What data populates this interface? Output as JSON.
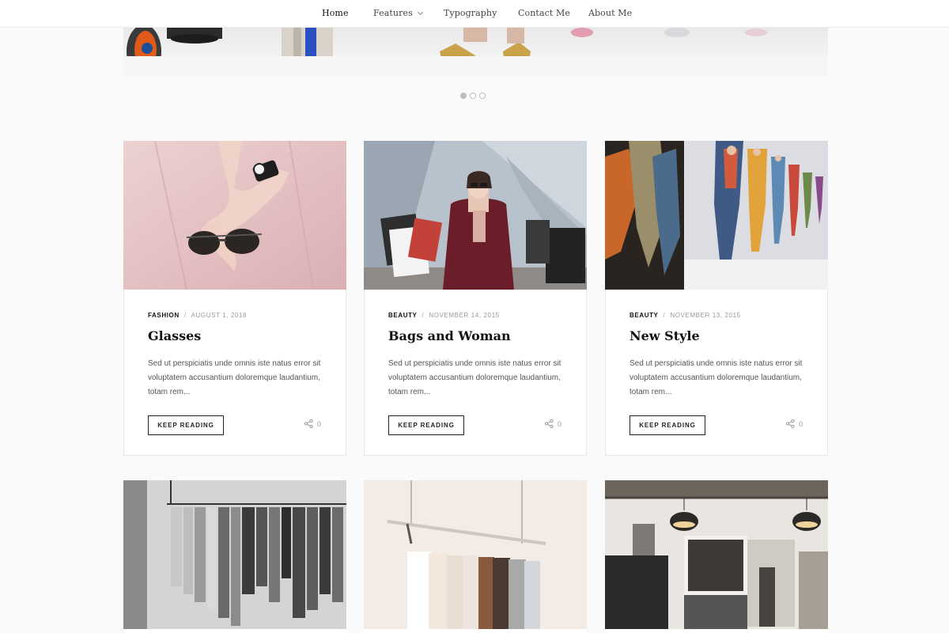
{
  "nav": {
    "items": [
      {
        "label": "Home",
        "active": true
      },
      {
        "label": "Features",
        "has_dropdown": true
      },
      {
        "label": "Typography"
      },
      {
        "label": "Contact Me"
      },
      {
        "label": "About Me"
      }
    ]
  },
  "slider": {
    "dots": 3,
    "active_dot": 1
  },
  "posts": [
    {
      "category": "Fashion",
      "date": "August 1, 2018",
      "title": "Glasses",
      "excerpt": "Sed ut perspiciatis unde omnis iste natus error sit voluptatem accusantium doloremque laudantium, totam rem...",
      "button": "Keep Reading",
      "share_count": "0"
    },
    {
      "category": "Beauty",
      "date": "November 14, 2015",
      "title": "Bags and Woman",
      "excerpt": "Sed ut perspiciatis unde omnis iste natus error sit voluptatem accusantium doloremque laudantium, totam rem...",
      "button": "Keep Reading",
      "share_count": "0"
    },
    {
      "category": "Beauty",
      "date": "November 13, 2015",
      "title": "New Style",
      "excerpt": "Sed ut perspiciatis unde omnis iste natus error sit voluptatem accusantium doloremque laudantium, totam rem...",
      "button": "Keep Reading",
      "share_count": "0"
    }
  ],
  "icons": {
    "share": "share-icon",
    "dropdown": "chevron-down-icon"
  },
  "colors": {
    "background": "#fafafa",
    "text": "#111111",
    "muted": "#999999"
  }
}
